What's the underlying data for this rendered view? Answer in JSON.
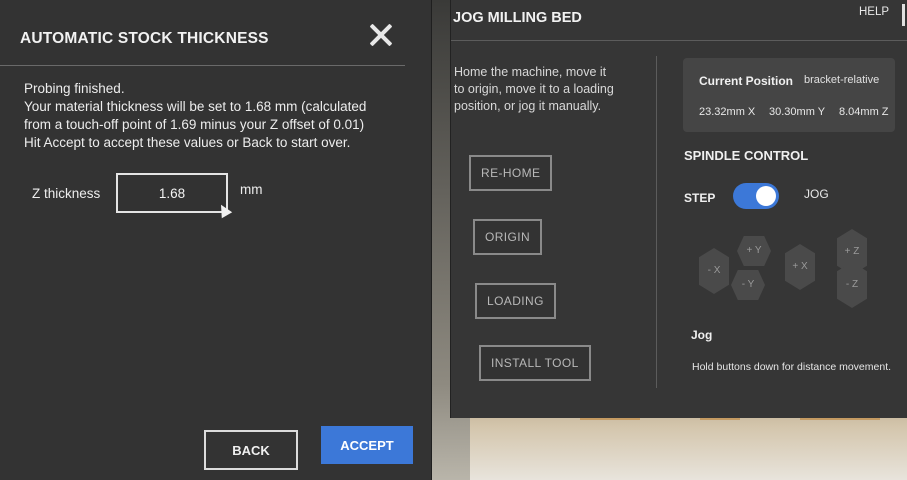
{
  "stock_dialog": {
    "title": "AUTOMATIC STOCK THICKNESS",
    "message_lines": [
      "Probing finished.",
      "Your material thickness will be set to 1.68 mm (calculated",
      "from a touch-off point of 1.69 minus your Z offset of 0.01)",
      "Hit Accept to accept these values or Back to start over."
    ],
    "z_label": "Z thickness",
    "z_value": "1.68",
    "z_unit": "mm",
    "back_label": "BACK",
    "accept_label": "ACCEPT"
  },
  "jog_panel": {
    "title": "JOG MILLING BED",
    "help_label": "HELP",
    "intro_lines": [
      "Home the machine, move it",
      "to origin, move it to a loading",
      "position, or jog it manually."
    ],
    "buttons": [
      "RE-HOME",
      "ORIGIN",
      "LOADING",
      "INSTALL TOOL"
    ],
    "position": {
      "title": "Current Position",
      "mode": "bracket-relative",
      "x": "23.32mm X",
      "y": "30.30mm Y",
      "z": "8.04mm Z"
    },
    "spindle": {
      "title": "SPINDLE CONTROL",
      "step_label": "STEP",
      "jog_label": "JOG",
      "toggle_on": true
    },
    "jog_keys": {
      "minus_x": "- X",
      "plus_y": "+ Y",
      "minus_y": "- Y",
      "plus_x": "+ X",
      "plus_z": "+ Z",
      "minus_z": "- Z"
    },
    "jog_heading": "Jog",
    "jog_hint": "Hold buttons down for distance movement."
  },
  "colors": {
    "accent": "#3c78d8",
    "panel": "#333333"
  }
}
